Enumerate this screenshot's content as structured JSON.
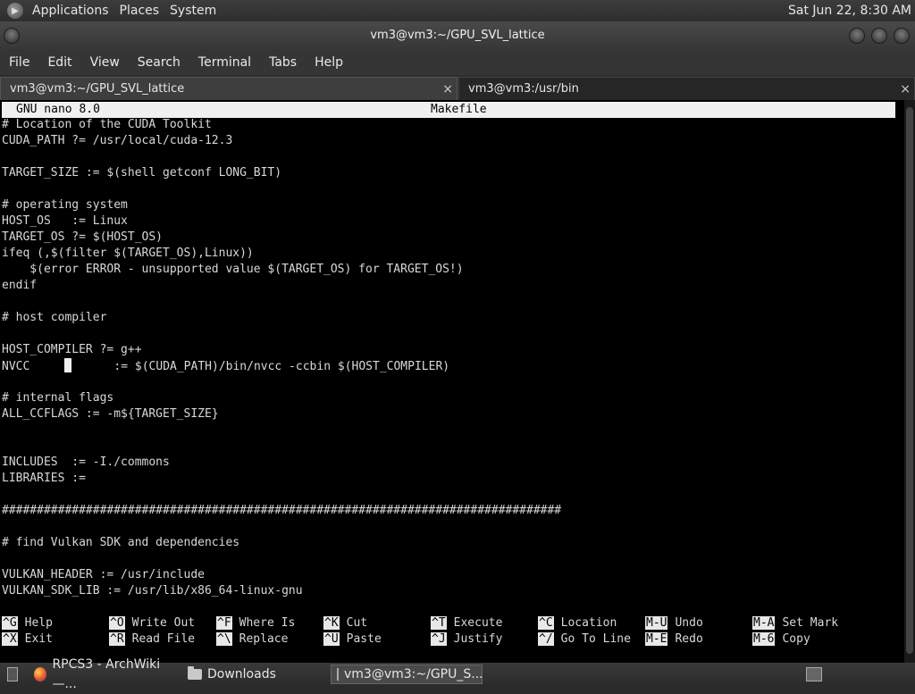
{
  "top_panel": {
    "menus": [
      "Applications",
      "Places",
      "System"
    ],
    "clock": "Sat Jun 22,  8:30 AM"
  },
  "window": {
    "title": "vm3@vm3:~/GPU_SVL_lattice"
  },
  "menu_bar": [
    "File",
    "Edit",
    "View",
    "Search",
    "Terminal",
    "Tabs",
    "Help"
  ],
  "tabs": [
    {
      "label": "vm3@vm3:~/GPU_SVL_lattice",
      "close": "×"
    },
    {
      "label": "vm3@vm3:/usr/bin",
      "close": "×"
    }
  ],
  "nano": {
    "version": "GNU nano 8.0",
    "filename": "Makefile",
    "lines": [
      "# Location of the CUDA Toolkit",
      "CUDA_PATH ?= /usr/local/cuda-12.3",
      "",
      "TARGET_SIZE := $(shell getconf LONG_BIT)",
      "",
      "# operating system",
      "HOST_OS   := Linux",
      "TARGET_OS ?= $(HOST_OS)",
      "ifeq (,$(filter $(TARGET_OS),Linux))",
      "    $(error ERROR - unsupported value $(TARGET_OS) for TARGET_OS!)",
      "endif",
      "",
      "# host compiler",
      "",
      "HOST_COMPILER ?= g++",
      "",
      "",
      "# internal flags",
      "ALL_CCFLAGS := -m${TARGET_SIZE}",
      "",
      "",
      "INCLUDES  := -I./commons",
      "LIBRARIES :=",
      "",
      "################################################################################",
      "",
      "# find Vulkan SDK and dependencies",
      "",
      "VULKAN_HEADER := /usr/include",
      "VULKAN_SDK_LIB := /usr/lib/x86_64-linux-gnu"
    ],
    "nvcc_before_cursor": "NVCC     ",
    "nvcc_after_cursor": "      := $(CUDA_PATH)/bin/nvcc -ccbin $(HOST_COMPILER)",
    "shortcuts_row1": [
      {
        "key": "^G",
        "label": "Help"
      },
      {
        "key": "^O",
        "label": "Write Out"
      },
      {
        "key": "^F",
        "label": "Where Is"
      },
      {
        "key": "^K",
        "label": "Cut"
      },
      {
        "key": "^T",
        "label": "Execute"
      },
      {
        "key": "^C",
        "label": "Location"
      },
      {
        "key": "M-U",
        "label": "Undo"
      },
      {
        "key": "M-A",
        "label": "Set Mark"
      }
    ],
    "shortcuts_row2": [
      {
        "key": "^X",
        "label": "Exit"
      },
      {
        "key": "^R",
        "label": "Read File"
      },
      {
        "key": "^\\",
        "label": "Replace"
      },
      {
        "key": "^U",
        "label": "Paste"
      },
      {
        "key": "^J",
        "label": "Justify"
      },
      {
        "key": "^/",
        "label": "Go To Line"
      },
      {
        "key": "M-E",
        "label": "Redo"
      },
      {
        "key": "M-6",
        "label": "Copy"
      }
    ]
  },
  "taskbar": {
    "items": [
      {
        "label": "RPCS3 - ArchWiki —...",
        "icon": "firefox-icon"
      },
      {
        "label": "Downloads",
        "icon": "folder-icon"
      },
      {
        "label": "vm3@vm3:~/GPU_S...",
        "icon": "terminal-icon"
      }
    ]
  }
}
